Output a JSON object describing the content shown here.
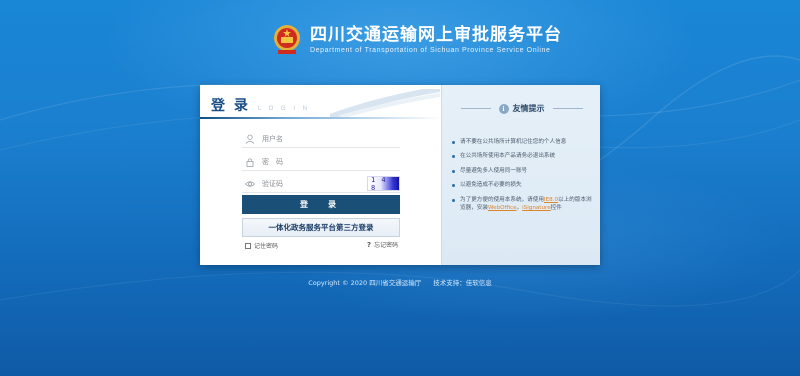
{
  "header": {
    "title": "四川交通运输网上审批服务平台",
    "subtitle": "Department of Transportation of Sichuan Province Service Online"
  },
  "login": {
    "title": "登 录",
    "title_en": "L O G I N",
    "username_placeholder": "用户名",
    "password_placeholder": "密　码",
    "captcha_placeholder": "验证码",
    "captcha_text": "1 4 5 8",
    "submit_label": "登　录",
    "third_party_label": "一体化政务服务平台第三方登录",
    "remember_label": "记住密码",
    "forgot_label": "忘记密码"
  },
  "tips": {
    "title": "友情提示",
    "items": [
      "请不要在公共场所计算机记住您的个人信息",
      "在公共场所使用本产品请务必退出系统",
      "尽量避免多人使用同一账号",
      "以避免造成不必要的损失"
    ],
    "browser_tip": {
      "prefix": "为了更方便的使用本系统，请使用",
      "ie": "IE8.0",
      "middle": "以上的版本浏览器，安装",
      "webedit": "WebOffice",
      "separator": "，",
      "signature": "iSignature",
      "suffix": "控件"
    }
  },
  "footer": {
    "copyright": "Copyright © 2020 四川省交通运输厅",
    "support": "技术支持：佳软信息"
  },
  "colors": {
    "primary": "#1a4f78",
    "background": "#1b7fcf",
    "link": "#e0862a"
  }
}
